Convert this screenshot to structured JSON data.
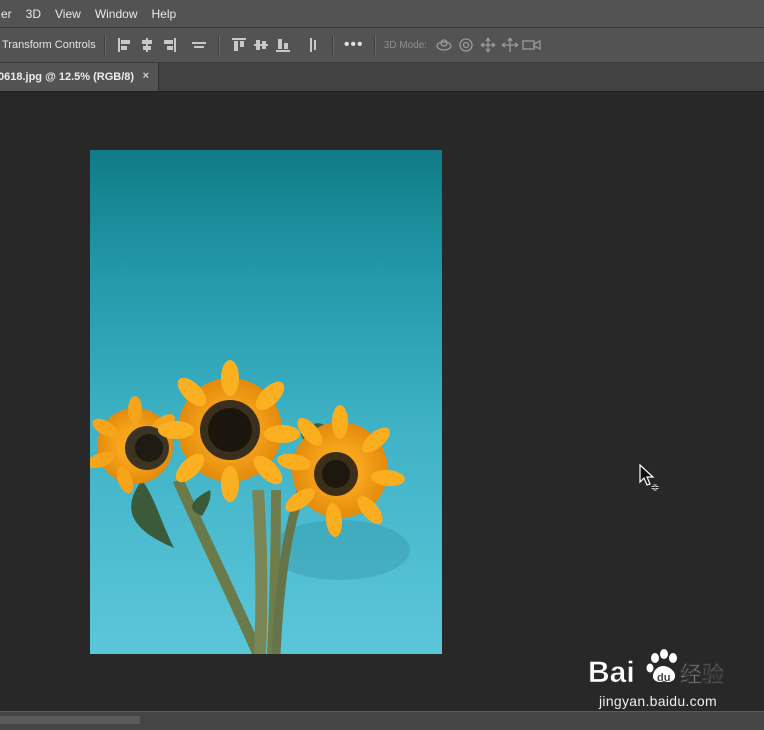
{
  "menu": {
    "items": [
      "er",
      "3D",
      "View",
      "Window",
      "Help"
    ]
  },
  "options_bar": {
    "transform_label": "Transform Controls",
    "mode_label": "3D Mode:",
    "more_label": "•••"
  },
  "document_tab": {
    "title": "0618.jpg @ 12.5% (RGB/8)",
    "close_label": "×"
  },
  "watermark": {
    "logo_text": "Baidu 经验",
    "url": "jingyan.baidu.com"
  },
  "icons": {
    "align": [
      "align-left-edges-icon",
      "align-horizontal-centers-icon",
      "align-right-edges-icon",
      "distribute-icon",
      "align-top-edges-icon",
      "align-vertical-centers-icon",
      "align-bottom-edges-icon",
      "distribute-vertical-icon"
    ],
    "mode": [
      "orbit-3d-icon",
      "roll-3d-icon",
      "drag-3d-icon",
      "slide-3d-icon",
      "scale-3d-camera-icon"
    ]
  },
  "colors": {
    "menubar": "#535353",
    "canvas": "#282828",
    "photo_sky": "#37aac0"
  }
}
